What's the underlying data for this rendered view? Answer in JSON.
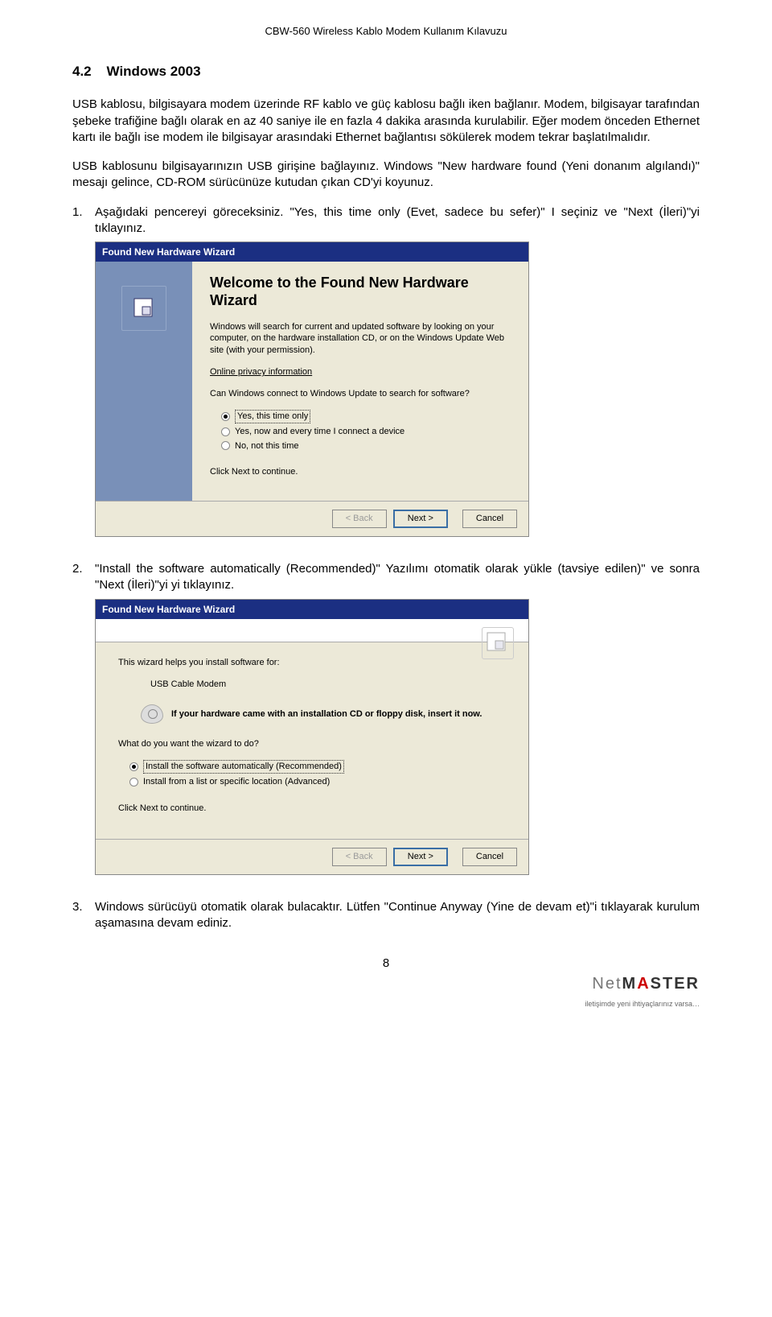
{
  "header": "CBW-560 Wireless Kablo Modem Kullanım Kılavuzu",
  "section": {
    "number": "4.2",
    "title": "Windows 2003"
  },
  "para1": "USB kablosu, bilgisayara modem üzerinde RF kablo ve güç kablosu bağlı iken bağlanır. Modem, bilgisayar tarafından şebeke trafiğine bağlı olarak en az 40 saniye ile en fazla 4 dakika arasında kurulabilir. Eğer modem önceden Ethernet kartı ile bağlı ise modem ile bilgisayar arasındaki Ethernet bağlantısı sökülerek modem tekrar başlatılmalıdır.",
  "para2": "USB kablosunu bilgisayarınızın USB girişine bağlayınız. Windows \"New hardware found (Yeni donanım algılandı)\" mesajı gelince, CD-ROM sürücünüze kutudan çıkan CD'yi koyunuz.",
  "step1": {
    "num": "1.",
    "text": "Aşağıdaki pencereyi göreceksiniz. \"Yes, this time only (Evet, sadece bu sefer)\" I seçiniz ve \"Next (İleri)\"yi tıklayınız."
  },
  "wiz1": {
    "titlebar": "Found New Hardware Wizard",
    "heading": "Welcome to the Found New Hardware Wizard",
    "body1": "Windows will search for current and updated software by looking on your computer, on the hardware installation CD, or on the Windows Update Web site (with your permission).",
    "link": "Online privacy information",
    "body2": "Can Windows connect to Windows Update to search for software?",
    "opt1": "Yes, this time only",
    "opt2": "Yes, now and every time I connect a device",
    "opt3": "No, not this time",
    "cont": "Click Next to continue.",
    "back": "< Back",
    "next": "Next >",
    "cancel": "Cancel"
  },
  "step2": {
    "num": "2.",
    "text": "\"Install the software automatically (Recommended)\" Yazılımı otomatik olarak yükle (tavsiye edilen)\" ve sonra \"Next (İleri)\"yi yi tıklayınız."
  },
  "wiz2": {
    "titlebar": "Found New Hardware Wizard",
    "help": "This wizard helps you install software for:",
    "device": "USB Cable Modem",
    "cdmsg": "If your hardware came with an installation CD or floppy disk, insert it now.",
    "ask": "What do you want the wizard to do?",
    "opt1": "Install the software automatically (Recommended)",
    "opt2": "Install from a list or specific location (Advanced)",
    "cont": "Click Next to continue.",
    "back": "< Back",
    "next": "Next >",
    "cancel": "Cancel"
  },
  "step3": {
    "num": "3.",
    "text": "Windows sürücüyü otomatik olarak bulacaktır. Lütfen \"Continue Anyway (Yine de devam et)\"i tıklayarak kurulum aşamasına devam ediniz."
  },
  "page": "8",
  "brand": {
    "net": "Net",
    "master": "M",
    "a": "A",
    "ster": "STER",
    "sub": "iletişimde yeni ihtiyaçlarınız varsa…"
  }
}
